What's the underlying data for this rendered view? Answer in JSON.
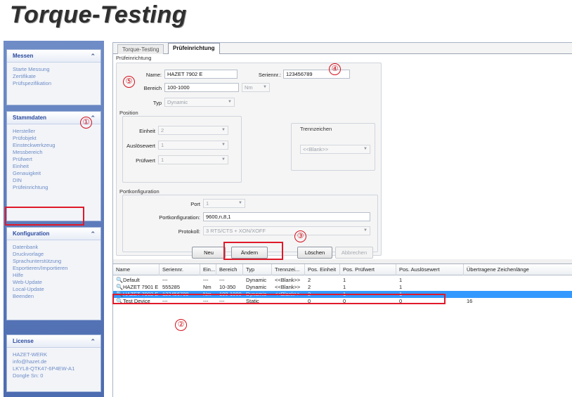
{
  "app_title": "Torque-Testing",
  "sidebar": {
    "groups": [
      {
        "title": "Messen",
        "items": [
          "Starte Messung",
          "Zertifikate",
          "Prüfspezifikation"
        ]
      },
      {
        "title": "Stammdaten",
        "items": [
          "Hersteller",
          "Prüfobjekt",
          "Einsteckwerkzeug",
          "Messbereich",
          "Prüfwert",
          "Einheit",
          "Genauigkeit",
          "DIN",
          "Prüfeinrichtung"
        ]
      },
      {
        "title": "Konfiguration",
        "items": [
          "Datenbank",
          "Druckvorlage",
          "Sprachunterstützung",
          "Esportieren/Importieren",
          "Hilfe",
          "Web-Update",
          "Local-Update",
          "Beenden"
        ]
      },
      {
        "title": "License",
        "items": [
          "HAZET-WERK",
          "info@hazet.de",
          "LKYL8-QTK47-6P4EW-A1",
          "Dongle Sn: 0"
        ]
      }
    ]
  },
  "tabs": [
    {
      "label": "Torque-Testing"
    },
    {
      "label": "Prüfeinrichtung"
    }
  ],
  "form": {
    "section_title": "Prüfeinrichtung",
    "name_label": "Name:",
    "name_value": "HAZET 7902 E",
    "serial_label": "Seriennr.:",
    "serial_value": "123456789",
    "range_label": "Bereich",
    "range_value": "100-1000",
    "unit_value": "Nm",
    "type_label": "Typ",
    "type_value": "Dynamic",
    "position_title": "Position",
    "unit_label": "Einheit",
    "unit_pos_value": "2",
    "trigger_label": "Auslösewert",
    "trigger_value": "1",
    "test_label": "Prüfwert",
    "test_value": "1",
    "separator_title": "Trennzeichen",
    "separator_value": "<<Blank>>",
    "port_title": "Portkonfiguration",
    "port_label": "Port",
    "port_value": "1",
    "portconfig_label": "Portkonfiguration:",
    "portconfig_value": "9600,n,8,1",
    "protocol_label": "Protokoll:",
    "protocol_value": "3 RTS/CTS + XON/XOFF"
  },
  "buttons": {
    "new": "Neu",
    "change": "Ändern",
    "delete": "Löschen",
    "cancel": "Abbrechen"
  },
  "table": {
    "columns": [
      "Name",
      "Seriennr.",
      "Ein...",
      "Bereich",
      "Typ",
      "Trennzei...",
      "Pos. Einheit",
      "Pos. Prüfwert",
      "Pos. Auslösewert",
      "Übertragene Zeichenlänge"
    ],
    "rows": [
      [
        "Default",
        "---",
        "---",
        "---",
        "Dynamic",
        "<<Blank>>",
        "2",
        "1",
        "1",
        ""
      ],
      [
        "HAZET 7901 E",
        "555285",
        "Nm",
        "10-350",
        "Dynamic",
        "<<Blank>>",
        "2",
        "1",
        "1",
        ""
      ],
      [
        "HAZET 7902 E",
        "123456789",
        "Nm",
        "100-1000",
        "Dynamic",
        "<<Blank>>",
        "2",
        "1",
        "1",
        ""
      ],
      [
        "Test Device",
        "---",
        "---",
        "---",
        "Static",
        "",
        "0",
        "0",
        "0",
        "16"
      ]
    ],
    "selected_row": 2
  },
  "markers": [
    "①",
    "②",
    "③",
    "④",
    "⑤"
  ],
  "colors": {
    "sidebar": "#5b78b8",
    "nav_text": "#6d8cc6",
    "selection": "#3399ff",
    "callout": "#e0192a"
  }
}
